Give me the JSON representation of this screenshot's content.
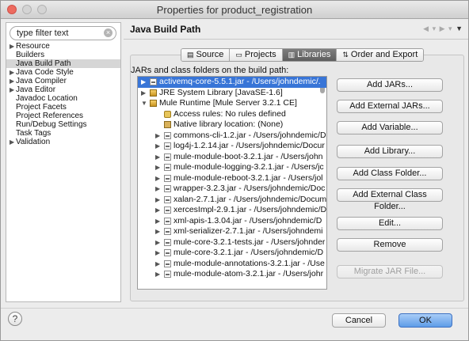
{
  "window": {
    "title": "Properties for product_registration"
  },
  "sidebar": {
    "filter_text": "type filter text",
    "items": [
      {
        "label": "Resource",
        "expandable": true
      },
      {
        "label": "Builders",
        "expandable": false
      },
      {
        "label": "Java Build Path",
        "expandable": false,
        "selected": true
      },
      {
        "label": "Java Code Style",
        "expandable": true
      },
      {
        "label": "Java Compiler",
        "expandable": true
      },
      {
        "label": "Java Editor",
        "expandable": true
      },
      {
        "label": "Javadoc Location",
        "expandable": false
      },
      {
        "label": "Project Facets",
        "expandable": false
      },
      {
        "label": "Project References",
        "expandable": false
      },
      {
        "label": "Run/Debug Settings",
        "expandable": false
      },
      {
        "label": "Task Tags",
        "expandable": false
      },
      {
        "label": "Validation",
        "expandable": true
      }
    ]
  },
  "page": {
    "title": "Java Build Path"
  },
  "tabs": [
    {
      "label": "Source",
      "icon": "source-folder-icon",
      "active": false
    },
    {
      "label": "Projects",
      "icon": "projects-icon",
      "active": false
    },
    {
      "label": "Libraries",
      "icon": "libraries-icon",
      "active": true
    },
    {
      "label": "Order and Export",
      "icon": "order-export-icon",
      "active": false
    }
  ],
  "libraries": {
    "list_label": "JARs and class folders on the build path:",
    "entries": [
      {
        "text": "activemq-core-5.5.1.jar - /Users/johndemic/.",
        "level": 0,
        "expander": "collapsed",
        "icon": "jar",
        "selected": true
      },
      {
        "text": "JRE System Library [JavaSE-1.6]",
        "level": 0,
        "expander": "collapsed",
        "icon": "lib"
      },
      {
        "text": "Mule Runtime [Mule Server 3.2.1 CE]",
        "level": 0,
        "expander": "expanded",
        "icon": "lib"
      },
      {
        "text": "Access rules: No rules defined",
        "level": 1,
        "expander": "none",
        "icon": "rule"
      },
      {
        "text": "Native library location: (None)",
        "level": 1,
        "expander": "none",
        "icon": "native"
      },
      {
        "text": "commons-cli-1.2.jar - /Users/johndemic/D",
        "level": 1,
        "expander": "collapsed",
        "icon": "jar"
      },
      {
        "text": "log4j-1.2.14.jar - /Users/johndemic/Docur",
        "level": 1,
        "expander": "collapsed",
        "icon": "jar"
      },
      {
        "text": "mule-module-boot-3.2.1.jar - /Users/john",
        "level": 1,
        "expander": "collapsed",
        "icon": "jar"
      },
      {
        "text": "mule-module-logging-3.2.1.jar - /Users/jc",
        "level": 1,
        "expander": "collapsed",
        "icon": "jar"
      },
      {
        "text": "mule-module-reboot-3.2.1.jar - /Users/jol",
        "level": 1,
        "expander": "collapsed",
        "icon": "jar"
      },
      {
        "text": "wrapper-3.2.3.jar - /Users/johndemic/Doc",
        "level": 1,
        "expander": "collapsed",
        "icon": "jar"
      },
      {
        "text": "xalan-2.7.1.jar - /Users/johndemic/Docum",
        "level": 1,
        "expander": "collapsed",
        "icon": "jar"
      },
      {
        "text": "xercesImpl-2.9.1.jar - /Users/johndemic/D",
        "level": 1,
        "expander": "collapsed",
        "icon": "jar"
      },
      {
        "text": "xml-apis-1.3.04.jar - /Users/johndemic/D",
        "level": 1,
        "expander": "collapsed",
        "icon": "jar"
      },
      {
        "text": "xml-serializer-2.7.1.jar - /Users/johndemi",
        "level": 1,
        "expander": "collapsed",
        "icon": "jar"
      },
      {
        "text": "mule-core-3.2.1-tests.jar - /Users/johnder",
        "level": 1,
        "expander": "collapsed",
        "icon": "jar"
      },
      {
        "text": "mule-core-3.2.1.jar - /Users/johndemic/D",
        "level": 1,
        "expander": "collapsed",
        "icon": "jar"
      },
      {
        "text": "mule-module-annotations-3.2.1.jar - /Use",
        "level": 1,
        "expander": "collapsed",
        "icon": "jar"
      },
      {
        "text": "mule-module-atom-3.2.1.jar - /Users/johr",
        "level": 1,
        "expander": "collapsed",
        "icon": "jar"
      }
    ],
    "buttons": [
      {
        "label": "Add JARs...",
        "enabled": true
      },
      {
        "label": "Add External JARs...",
        "enabled": true
      },
      {
        "label": "Add Variable...",
        "enabled": true
      },
      {
        "label": "Add Library...",
        "enabled": true
      },
      {
        "label": "Add Class Folder...",
        "enabled": true
      },
      {
        "label": "Add External Class Folder...",
        "enabled": true
      },
      {
        "label": "Edit...",
        "enabled": true
      },
      {
        "label": "Remove",
        "enabled": true
      },
      {
        "label": "Migrate JAR File...",
        "enabled": false
      }
    ]
  },
  "footer": {
    "help_label": "?",
    "cancel_label": "Cancel",
    "ok_label": "OK"
  },
  "colors": {
    "selection": "#3875d7",
    "ok_button": "#5e9ce8",
    "close_button": "#ed6b5f"
  }
}
